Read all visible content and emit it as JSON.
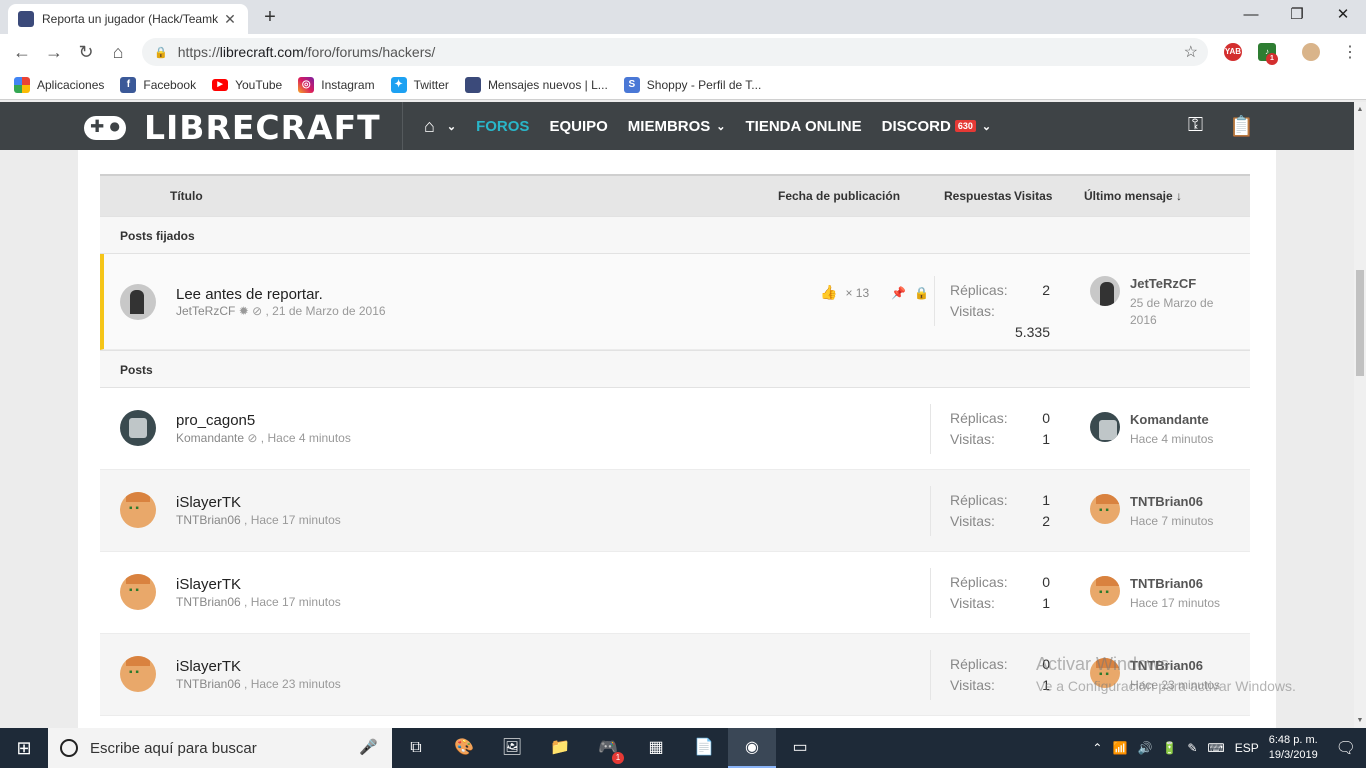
{
  "browser": {
    "tab_title": "Reporta un jugador (Hack/Teamk",
    "url_prefix": "https://",
    "url_host": "librecraft.com",
    "url_path": "/foro/forums/hackers/",
    "ext1": "YAB",
    "ext2_badge": "1"
  },
  "bookmarks": [
    {
      "label": "Aplicaciones",
      "icon": "apps-grid-icon"
    },
    {
      "label": "Facebook",
      "icon": "facebook-icon"
    },
    {
      "label": "YouTube",
      "icon": "youtube-icon"
    },
    {
      "label": "Instagram",
      "icon": "instagram-icon"
    },
    {
      "label": "Twitter",
      "icon": "twitter-icon"
    },
    {
      "label": "Mensajes nuevos | L...",
      "icon": "librecraft-icon"
    },
    {
      "label": "Shoppy - Perfil de T...",
      "icon": "shoppy-icon"
    }
  ],
  "site": {
    "logo": "LIBRECRAFT",
    "nav": {
      "foros": "FOROS",
      "equipo": "EQUIPO",
      "miembros": "MIEMBROS",
      "tienda": "TIENDA ONLINE",
      "discord": "DISCORD",
      "discord_badge": "630"
    }
  },
  "table": {
    "headers": {
      "title": "Título",
      "date": "Fecha de publicación",
      "replies": "Respuestas",
      "views": "Visitas",
      "last": "Último mensaje ↓"
    },
    "sticky_label": "Posts fijados",
    "posts_label": "Posts",
    "replies_label": "Réplicas:",
    "views_label": "Visitas:",
    "sticky": {
      "title": "Lee antes de reportar.",
      "author": "JetTeRzCF",
      "date": "21 de Marzo de 2016",
      "likes": "× 13",
      "replies": "2",
      "views": "5.335",
      "last_user": "JetTeRzCF",
      "last_time": "25 de Marzo de 2016"
    },
    "posts": [
      {
        "title": "pro_cagon5",
        "author": "Komandante",
        "time": "Hace 4 minutos",
        "replies": "0",
        "views": "1",
        "last_user": "Komandante",
        "last_time": "Hace 4 minutos"
      },
      {
        "title": "iSlayerTK",
        "author": "TNTBrian06",
        "time": "Hace 17 minutos",
        "replies": "1",
        "views": "2",
        "last_user": "TNTBrian06",
        "last_time": "Hace 7 minutos"
      },
      {
        "title": "iSlayerTK",
        "author": "TNTBrian06",
        "time": "Hace 17 minutos",
        "replies": "0",
        "views": "1",
        "last_user": "TNTBrian06",
        "last_time": "Hace 17 minutos"
      },
      {
        "title": "iSlayerTK",
        "author": "TNTBrian06",
        "time": "Hace 23 minutos",
        "replies": "0",
        "views": "1",
        "last_user": "TNTBrian06",
        "last_time": "Hace 23 minutos"
      }
    ]
  },
  "watermark": {
    "line1": "Activar Windows",
    "line2": "Ve a Configuración para activar Windows."
  },
  "taskbar": {
    "search": "Escribe aquí para buscar",
    "lang": "ESP",
    "time": "6:48 p. m.",
    "date": "19/3/2019",
    "discord_badge": "1"
  }
}
